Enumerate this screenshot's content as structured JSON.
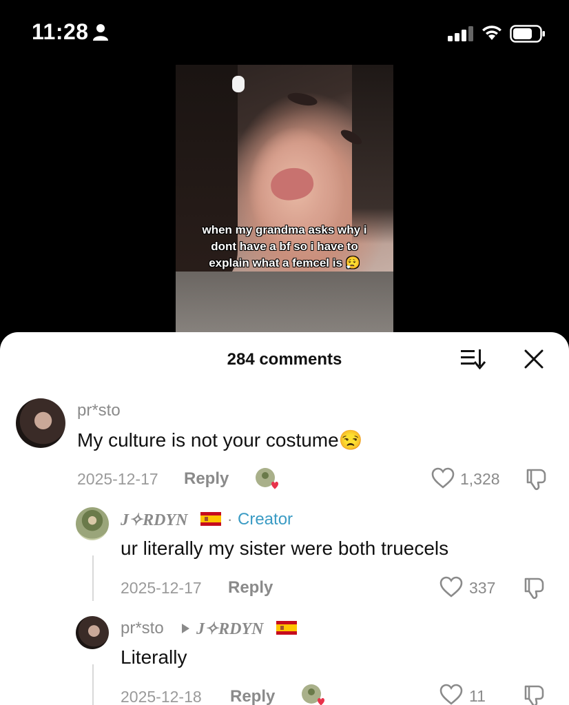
{
  "status_bar": {
    "time": "11:28"
  },
  "video": {
    "caption": "when my grandma asks why i dont have a bf so i have to explain what a femcel is 😮‍💨"
  },
  "comments_sheet": {
    "title": "284 comments",
    "comments": [
      {
        "username": "pr*sto",
        "text": "My culture is not your costume😒",
        "date": "2025-12-17",
        "reply_label": "Reply",
        "likes": "1,328"
      },
      {
        "username": "J✧RDYN",
        "creator_separator": "·",
        "creator_badge": "Creator",
        "text": "ur literally my sister were both truecels",
        "date": "2025-12-17",
        "reply_label": "Reply",
        "likes": "337"
      },
      {
        "username": "pr*sto",
        "reply_to": "J✧RDYN",
        "text": "Literally",
        "date": "2025-12-18",
        "reply_label": "Reply",
        "likes": "11"
      }
    ]
  },
  "colors": {
    "creator_accent": "#3a9bc4",
    "heart_red": "#e8324a"
  }
}
